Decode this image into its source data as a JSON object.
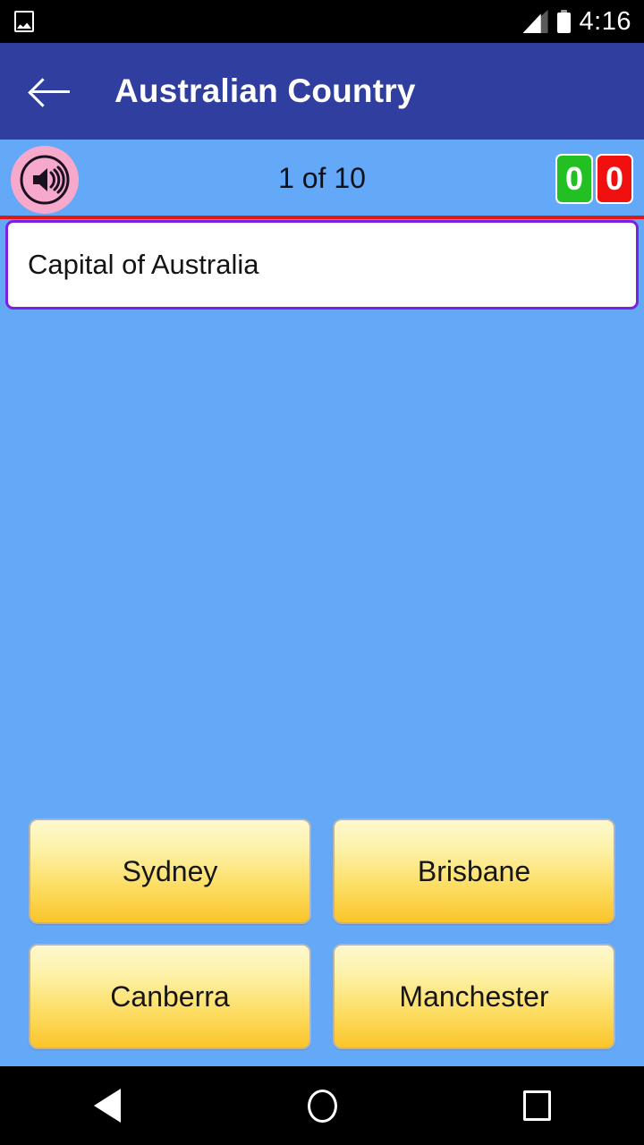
{
  "status_bar": {
    "notification_icon": "photo-icon",
    "signal_icon": "signal-bars-icon",
    "battery_icon": "battery-full-icon",
    "time": "4:16"
  },
  "app_bar": {
    "back_icon": "back-arrow-icon",
    "title": "Australian Country"
  },
  "quiz": {
    "sound_icon": "speaker-volume-icon",
    "progress": "1 of 10",
    "score": {
      "correct": "0",
      "wrong": "0",
      "correct_color": "#22c022",
      "wrong_color": "#f01010"
    },
    "question": "Capital of Australia",
    "answers": [
      {
        "label": "Sydney"
      },
      {
        "label": "Brisbane"
      },
      {
        "label": "Canberra"
      },
      {
        "label": "Manchester"
      }
    ]
  },
  "nav_bar": {
    "back_label": "back-triangle-icon",
    "home_label": "home-circle-icon",
    "recents_label": "recents-square-icon"
  },
  "colors": {
    "app_bar": "#303f9f",
    "background": "#64a8f8",
    "card_border": "#7b1fe0",
    "divider": "#e01818",
    "sound_bubble": "#f7a9cc",
    "answer_top": "#fdf8cf",
    "answer_bottom": "#fbc52a"
  }
}
